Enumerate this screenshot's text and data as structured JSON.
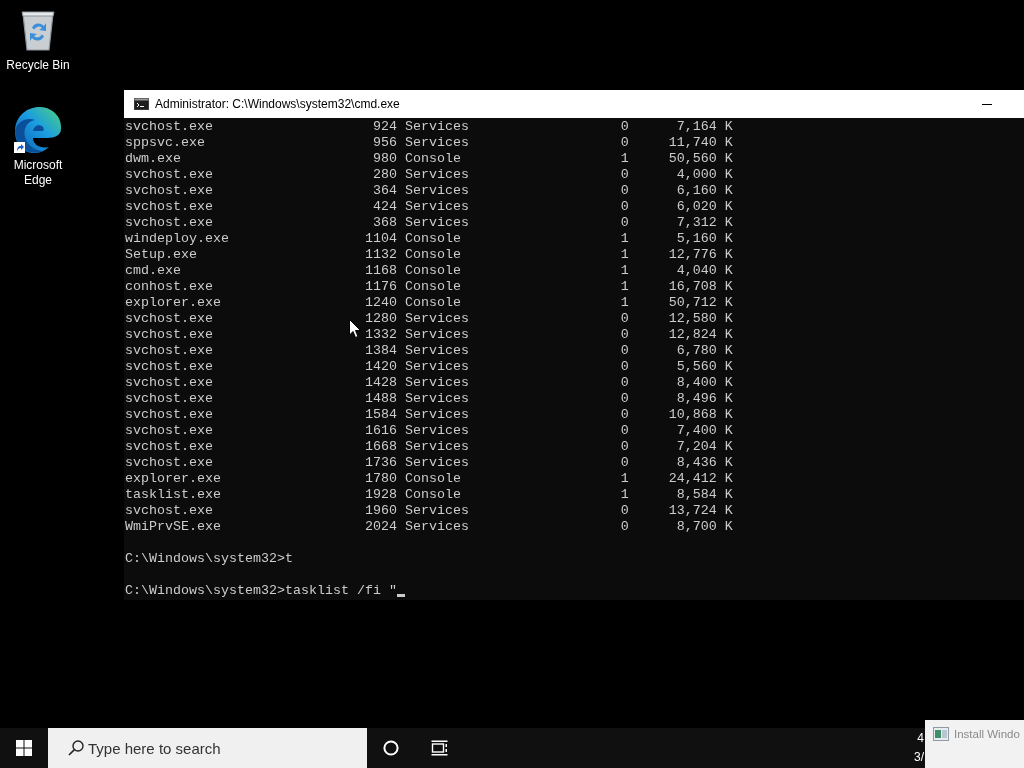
{
  "desktop_icons": [
    {
      "kind": "recycle_bin",
      "label": "Recycle Bin",
      "shortcut": false
    },
    {
      "kind": "browser",
      "label": "Microsoft Edge",
      "shortcut": true
    }
  ],
  "window": {
    "title": "Administrator: C:\\Windows\\system32\\cmd.exe",
    "console": {
      "rows": [
        {
          "image_name": "svchost.exe",
          "pid": "924",
          "session_name": "Services",
          "session_number": "0",
          "mem_usage": "7,164 K"
        },
        {
          "image_name": "sppsvc.exe",
          "pid": "956",
          "session_name": "Services",
          "session_number": "0",
          "mem_usage": "11,740 K"
        },
        {
          "image_name": "dwm.exe",
          "pid": "980",
          "session_name": "Console",
          "session_number": "1",
          "mem_usage": "50,560 K"
        },
        {
          "image_name": "svchost.exe",
          "pid": "280",
          "session_name": "Services",
          "session_number": "0",
          "mem_usage": "4,000 K"
        },
        {
          "image_name": "svchost.exe",
          "pid": "364",
          "session_name": "Services",
          "session_number": "0",
          "mem_usage": "6,160 K"
        },
        {
          "image_name": "svchost.exe",
          "pid": "424",
          "session_name": "Services",
          "session_number": "0",
          "mem_usage": "6,020 K"
        },
        {
          "image_name": "svchost.exe",
          "pid": "368",
          "session_name": "Services",
          "session_number": "0",
          "mem_usage": "7,312 K"
        },
        {
          "image_name": "windeploy.exe",
          "pid": "1104",
          "session_name": "Console",
          "session_number": "1",
          "mem_usage": "5,160 K"
        },
        {
          "image_name": "Setup.exe",
          "pid": "1132",
          "session_name": "Console",
          "session_number": "1",
          "mem_usage": "12,776 K"
        },
        {
          "image_name": "cmd.exe",
          "pid": "1168",
          "session_name": "Console",
          "session_number": "1",
          "mem_usage": "4,040 K"
        },
        {
          "image_name": "conhost.exe",
          "pid": "1176",
          "session_name": "Console",
          "session_number": "1",
          "mem_usage": "16,708 K"
        },
        {
          "image_name": "explorer.exe",
          "pid": "1240",
          "session_name": "Console",
          "session_number": "1",
          "mem_usage": "50,712 K"
        },
        {
          "image_name": "svchost.exe",
          "pid": "1280",
          "session_name": "Services",
          "session_number": "0",
          "mem_usage": "12,580 K"
        },
        {
          "image_name": "svchost.exe",
          "pid": "1332",
          "session_name": "Services",
          "session_number": "0",
          "mem_usage": "12,824 K"
        },
        {
          "image_name": "svchost.exe",
          "pid": "1384",
          "session_name": "Services",
          "session_number": "0",
          "mem_usage": "6,780 K"
        },
        {
          "image_name": "svchost.exe",
          "pid": "1420",
          "session_name": "Services",
          "session_number": "0",
          "mem_usage": "5,560 K"
        },
        {
          "image_name": "svchost.exe",
          "pid": "1428",
          "session_name": "Services",
          "session_number": "0",
          "mem_usage": "8,400 K"
        },
        {
          "image_name": "svchost.exe",
          "pid": "1488",
          "session_name": "Services",
          "session_number": "0",
          "mem_usage": "8,496 K"
        },
        {
          "image_name": "svchost.exe",
          "pid": "1584",
          "session_name": "Services",
          "session_number": "0",
          "mem_usage": "10,868 K"
        },
        {
          "image_name": "svchost.exe",
          "pid": "1616",
          "session_name": "Services",
          "session_number": "0",
          "mem_usage": "7,400 K"
        },
        {
          "image_name": "svchost.exe",
          "pid": "1668",
          "session_name": "Services",
          "session_number": "0",
          "mem_usage": "7,204 K"
        },
        {
          "image_name": "svchost.exe",
          "pid": "1736",
          "session_name": "Services",
          "session_number": "0",
          "mem_usage": "8,436 K"
        },
        {
          "image_name": "explorer.exe",
          "pid": "1780",
          "session_name": "Console",
          "session_number": "1",
          "mem_usage": "24,412 K"
        },
        {
          "image_name": "tasklist.exe",
          "pid": "1928",
          "session_name": "Console",
          "session_number": "1",
          "mem_usage": "8,584 K"
        },
        {
          "image_name": "svchost.exe",
          "pid": "1960",
          "session_name": "Services",
          "session_number": "0",
          "mem_usage": "13,724 K"
        },
        {
          "image_name": "WmiPrvSE.exe",
          "pid": "2024",
          "session_name": "Services",
          "session_number": "0",
          "mem_usage": "8,700 K"
        }
      ],
      "prompts": [
        {
          "text": "C:\\Windows\\system32>t",
          "cursor": false
        },
        {
          "text": "C:\\Windows\\system32>tasklist /fi \"",
          "cursor": true
        }
      ]
    }
  },
  "taskbar": {
    "search": {
      "placeholder": "Type here to search"
    },
    "clock": {
      "time": "4",
      "date": "3/"
    },
    "preview": {
      "title": "Install Windo"
    }
  }
}
